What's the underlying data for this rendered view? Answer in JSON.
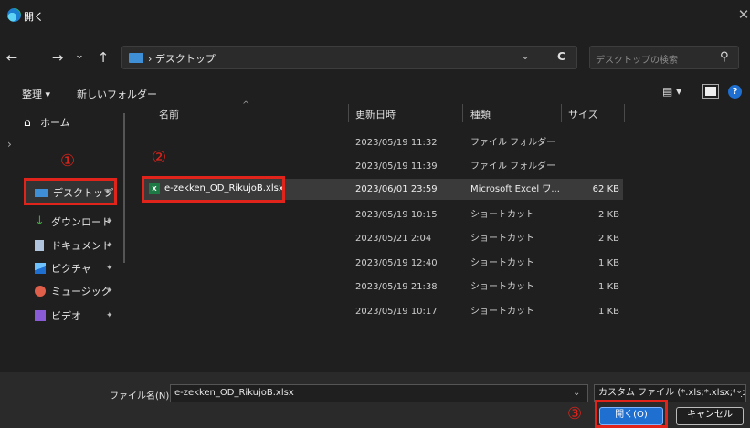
{
  "window": {
    "title": "開く",
    "close": "✕"
  },
  "nav": {
    "back": "←",
    "forward": "→",
    "dropdown": "⌄",
    "up": "↑",
    "address": "› デスクトップ",
    "addr_dropdown": "⌄",
    "refresh": "C",
    "search_placeholder": "デスクトップの検索",
    "search_icon": "⚲"
  },
  "toolbar": {
    "organize": "整理 ▾",
    "new_folder": "新しいフォルダー",
    "view": "▤ ▾"
  },
  "sidebar": {
    "home": "ホーム",
    "expand": "›",
    "items": [
      {
        "label": "デスクトップ",
        "icon": "desktop-icon",
        "color": "#3f8fd6"
      },
      {
        "label": "ダウンロード",
        "icon": "download-icon",
        "color": "#3fa83f"
      },
      {
        "label": "ドキュメント",
        "icon": "document-icon",
        "color": "#b0c4de"
      },
      {
        "label": "ピクチャ",
        "icon": "picture-icon",
        "color": "#2f87e0"
      },
      {
        "label": "ミュージック",
        "icon": "music-icon",
        "color": "#e05f4a"
      },
      {
        "label": "ビデオ",
        "icon": "video-icon",
        "color": "#8a5bd6"
      }
    ],
    "pin": "✦"
  },
  "columns": {
    "name": "名前",
    "date": "更新日時",
    "type": "種類",
    "size": "サイズ",
    "sort": "^"
  },
  "files": [
    {
      "name": "",
      "date": "2023/05/19 11:32",
      "type": "ファイル フォルダー",
      "size": ""
    },
    {
      "name": "",
      "date": "2023/05/19 11:39",
      "type": "ファイル フォルダー",
      "size": ""
    },
    {
      "name": "e-zekken_OD_RikujoB.xlsx",
      "date": "2023/06/01 23:59",
      "type": "Microsoft Excel ワ...",
      "size": "62 KB"
    },
    {
      "name": "",
      "date": "2023/05/19 10:15",
      "type": "ショートカット",
      "size": "2 KB"
    },
    {
      "name": "",
      "date": "2023/05/21 2:04",
      "type": "ショートカット",
      "size": "2 KB"
    },
    {
      "name": "",
      "date": "2023/05/19 12:40",
      "type": "ショートカット",
      "size": "1 KB"
    },
    {
      "name": "",
      "date": "2023/05/19 21:38",
      "type": "ショートカット",
      "size": "1 KB"
    },
    {
      "name": "",
      "date": "2023/05/19 10:17",
      "type": "ショートカット",
      "size": "1 KB"
    }
  ],
  "bottom": {
    "filename_label": "ファイル名(N):",
    "filename_value": "e-zekken_OD_RikujoB.xlsx",
    "filename_dd": "⌄",
    "filetype": "カスタム ファイル (*.xls;*.xlsx;*.pdf;",
    "filetype_dd": "⌄",
    "open": "開く(O)",
    "cancel": "キャンセル"
  },
  "annotations": {
    "one": "①",
    "two": "②",
    "three": "③"
  },
  "colors": {
    "accent": "#1f6fd1",
    "annotation": "#e0241b",
    "selected_row": "#3a3a3a",
    "excel": "#1e7a44"
  }
}
